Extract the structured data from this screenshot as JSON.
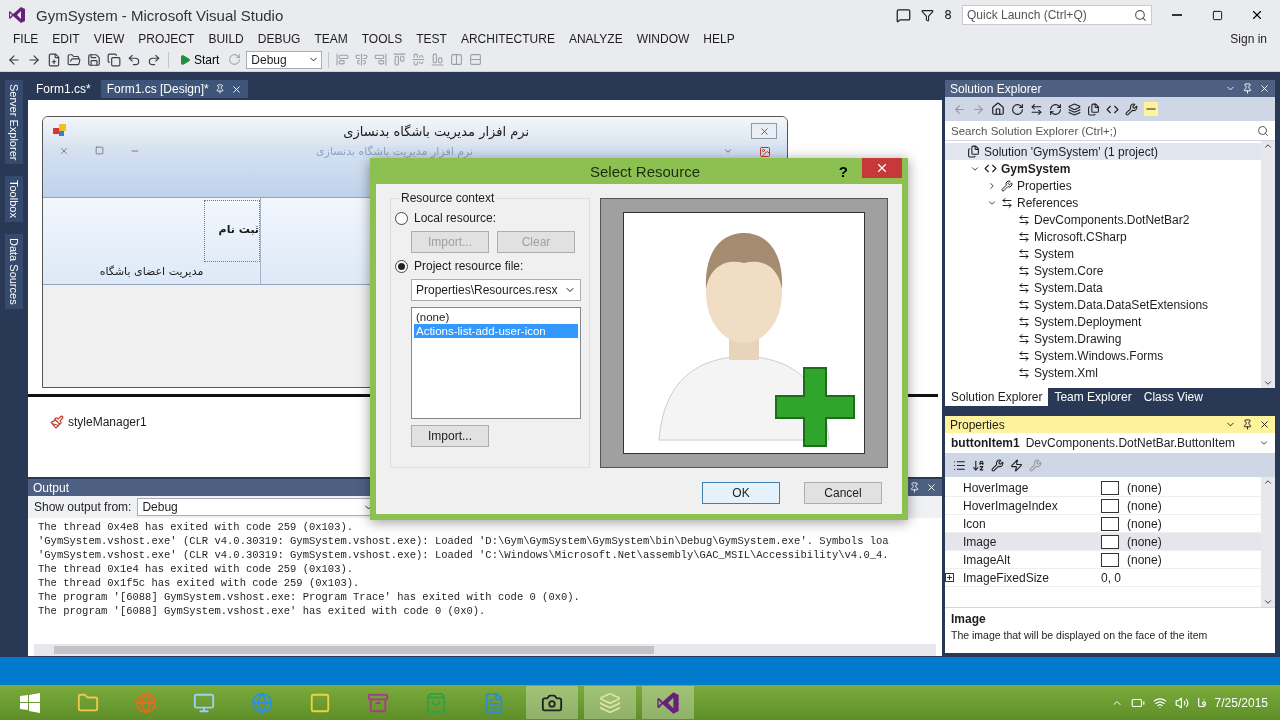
{
  "window": {
    "title": "GymSystem - Microsoft Visual Studio",
    "notification_count": "8",
    "quick_launch": {
      "placeholder": "Quick Launch (Ctrl+Q)"
    },
    "sign_in": "Sign in"
  },
  "menu": [
    "FILE",
    "EDIT",
    "VIEW",
    "PROJECT",
    "BUILD",
    "DEBUG",
    "TEAM",
    "TOOLS",
    "TEST",
    "ARCHITECTURE",
    "ANALYZE",
    "WINDOW",
    "HELP"
  ],
  "toolbar": {
    "start": "Start",
    "configuration": "Debug"
  },
  "side_tabs": [
    "Server Explorer",
    "Toolbox",
    "Data Sources"
  ],
  "document_tabs": [
    {
      "label": "Form1.cs*",
      "selected": false
    },
    {
      "label": "Form1.cs [Design]*",
      "selected": true
    }
  ],
  "designer": {
    "form_title": "نرم افزار مدیریت باشگاه بدنسازی",
    "ribbon_title": "نرم افزار مدیریت باشگاه بدنسازی",
    "ribbon_button": "ثبت نام",
    "ribbon_group": "مدیریت اعضای باشگاه",
    "components": [
      "styleManager1"
    ]
  },
  "output": {
    "title": "Output",
    "source_label": "Show output from:",
    "source": "Debug",
    "lines": [
      "The thread 0x4e8 has exited with code 259 (0x103).",
      "'GymSystem.vshost.exe' (CLR v4.0.30319: GymSystem.vshost.exe): Loaded 'D:\\Gym\\GymSystem\\GymSystem\\bin\\Debug\\GymSystem.exe'. Symbols loa",
      "'GymSystem.vshost.exe' (CLR v4.0.30319: GymSystem.vshost.exe): Loaded 'C:\\Windows\\Microsoft.Net\\assembly\\GAC_MSIL\\Accessibility\\v4.0_4.",
      "The thread 0x1e4 has exited with code 259 (0x103).",
      "The thread 0x1f5c has exited with code 259 (0x103).",
      "The program '[6088] GymSystem.vshost.exe: Program Trace' has exited with code 0 (0x0).",
      "The program '[6088] GymSystem.vshost.exe' has exited with code 0 (0x0)."
    ]
  },
  "solution_explorer": {
    "title": "Solution Explorer",
    "search": {
      "placeholder": "Search Solution Explorer (Ctrl+;)"
    },
    "tree": [
      {
        "label": "Solution 'GymSystem' (1 project)",
        "kind": "solution",
        "children": [
          {
            "label": "GymSystem",
            "kind": "project",
            "expanded": true,
            "children": [
              {
                "label": "Properties",
                "kind": "properties",
                "expanded": false
              },
              {
                "label": "References",
                "kind": "references",
                "expanded": true,
                "children": [
                  {
                    "label": "DevComponents.DotNetBar2",
                    "kind": "reference"
                  },
                  {
                    "label": "Microsoft.CSharp",
                    "kind": "reference"
                  },
                  {
                    "label": "System",
                    "kind": "reference"
                  },
                  {
                    "label": "System.Core",
                    "kind": "reference"
                  },
                  {
                    "label": "System.Data",
                    "kind": "reference"
                  },
                  {
                    "label": "System.Data.DataSetExtensions",
                    "kind": "reference"
                  },
                  {
                    "label": "System.Deployment",
                    "kind": "reference"
                  },
                  {
                    "label": "System.Drawing",
                    "kind": "reference"
                  },
                  {
                    "label": "System.Windows.Forms",
                    "kind": "reference"
                  },
                  {
                    "label": "System.Xml",
                    "kind": "reference"
                  }
                ]
              }
            ]
          }
        ]
      }
    ],
    "tabs": [
      {
        "label": "Solution Explorer",
        "selected": true
      },
      {
        "label": "Team Explorer",
        "selected": false
      },
      {
        "label": "Class View",
        "selected": false
      }
    ]
  },
  "properties": {
    "title": "Properties",
    "object_name": "buttonItem1",
    "object_type": "DevComponents.DotNetBar.ButtonItem",
    "rows": [
      {
        "name": "HoverImage",
        "value": "(none)",
        "kind": "image",
        "selected": false
      },
      {
        "name": "HoverImageIndex",
        "value": "(none)",
        "kind": "image",
        "selected": false
      },
      {
        "name": "Icon",
        "value": "(none)",
        "kind": "image",
        "selected": false
      },
      {
        "name": "Image",
        "value": "(none)",
        "kind": "image",
        "selected": true
      },
      {
        "name": "ImageAlt",
        "value": "(none)",
        "kind": "image",
        "selected": false
      },
      {
        "name": "ImageFixedSize",
        "value": "0, 0",
        "kind": "size",
        "selected": false
      }
    ],
    "description_title": "Image",
    "description": "The image that will be displayed on the face of the item"
  },
  "dialog": {
    "title": "Select Resource",
    "help": "?",
    "group_label": "Resource context",
    "options": [
      {
        "label": "Local resource:",
        "selected": false
      },
      {
        "label": "Project resource file:",
        "selected": true
      }
    ],
    "local_buttons": [
      {
        "label": "Import...",
        "disabled": true
      },
      {
        "label": "Clear",
        "disabled": true
      }
    ],
    "resource_file": "Properties\\Resources.resx",
    "resources": [
      {
        "label": "(none)",
        "selected": false
      },
      {
        "label": "Actions-list-add-user-icon",
        "selected": true
      }
    ],
    "import_button": "Import...",
    "buttons": [
      {
        "label": "OK",
        "default": true
      },
      {
        "label": "Cancel",
        "default": false
      }
    ]
  },
  "taskbar": {
    "language": "فا",
    "date": "7/25/2015"
  }
}
